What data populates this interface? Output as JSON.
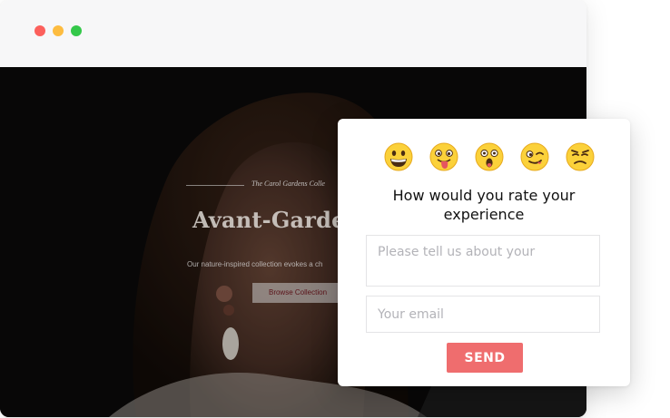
{
  "window": {
    "controls": [
      "close",
      "minimize",
      "zoom"
    ]
  },
  "hero": {
    "tagline": "The Carol Gardens Colle",
    "title": "Avant-Garde I",
    "description": "Our nature-inspired collection evokes a ch",
    "browse_button": "Browse Collection"
  },
  "feedback": {
    "emojis": [
      {
        "name": "grinning-face-icon"
      },
      {
        "name": "tongue-out-face-icon"
      },
      {
        "name": "astonished-face-icon"
      },
      {
        "name": "winking-face-icon"
      },
      {
        "name": "annoyed-face-icon"
      }
    ],
    "question_line1": "How would you rate your",
    "question_line2": "experience",
    "message_placeholder": "Please tell us about your",
    "email_placeholder": "Your email",
    "send_label": "SEND"
  },
  "colors": {
    "send_button": "#ef6d6e",
    "emoji_yellow": "#fbd13a",
    "close_dot": "#fc605c",
    "minimize_dot": "#fdbc40",
    "zoom_dot": "#34c84a"
  }
}
